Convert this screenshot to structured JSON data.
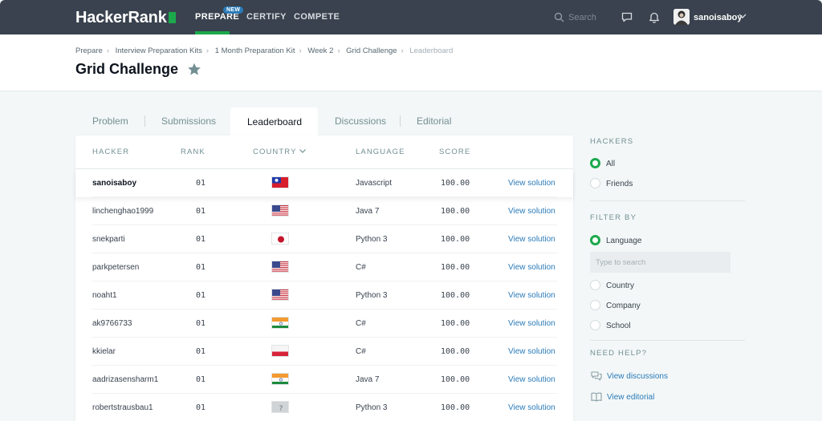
{
  "nav": {
    "logo": "HackerRank",
    "items": [
      {
        "label": "PREPARE",
        "active": true,
        "badge": "NEW"
      },
      {
        "label": "CERTIFY",
        "active": false
      },
      {
        "label": "COMPETE",
        "active": false
      }
    ],
    "search_placeholder": "Search",
    "username": "sanoisaboy",
    "icons": [
      "search-icon",
      "chat-icon",
      "bell-icon",
      "chevron-down-icon"
    ]
  },
  "breadcrumb": [
    "Prepare",
    "Interview Preparation Kits",
    "1 Month Preparation Kit",
    "Week 2",
    "Grid Challenge",
    "Leaderboard"
  ],
  "page_title": "Grid Challenge",
  "tabs": [
    "Problem",
    "Submissions",
    "Leaderboard",
    "Discussions",
    "Editorial"
  ],
  "active_tab": "Leaderboard",
  "table": {
    "headers": [
      "HACKER",
      "RANK",
      "COUNTRY",
      "LANGUAGE",
      "SCORE"
    ],
    "rows": [
      {
        "hacker": "sanoisaboy",
        "rank": "01",
        "country": "taiwan",
        "language": "Javascript",
        "score": "100.00",
        "action": "View solution"
      },
      {
        "hacker": "linchenghao1999",
        "rank": "01",
        "country": "usa",
        "language": "Java 7",
        "score": "100.00",
        "action": "View solution"
      },
      {
        "hacker": "snekparti",
        "rank": "01",
        "country": "japan",
        "language": "Python 3",
        "score": "100.00",
        "action": "View solution"
      },
      {
        "hacker": "parkpetersen",
        "rank": "01",
        "country": "usa",
        "language": "C#",
        "score": "100.00",
        "action": "View solution"
      },
      {
        "hacker": "noaht1",
        "rank": "01",
        "country": "usa",
        "language": "Python 3",
        "score": "100.00",
        "action": "View solution"
      },
      {
        "hacker": "ak9766733",
        "rank": "01",
        "country": "india",
        "language": "C#",
        "score": "100.00",
        "action": "View solution"
      },
      {
        "hacker": "kkielar",
        "rank": "01",
        "country": "poland",
        "language": "C#",
        "score": "100.00",
        "action": "View solution"
      },
      {
        "hacker": "aadrizasensharm1",
        "rank": "01",
        "country": "india",
        "language": "Java 7",
        "score": "100.00",
        "action": "View solution"
      },
      {
        "hacker": "robertstrausbau1",
        "rank": "01",
        "country": "unknown",
        "language": "Python 3",
        "score": "100.00",
        "action": "View solution"
      }
    ]
  },
  "sidebar": {
    "hackers_heading": "HACKERS",
    "hackers_options": [
      {
        "label": "All",
        "checked": true
      },
      {
        "label": "Friends",
        "checked": false
      }
    ],
    "filter_heading": "FILTER BY",
    "filter_options": [
      {
        "label": "Language",
        "checked": true
      },
      {
        "label": "Country",
        "checked": false
      },
      {
        "label": "Company",
        "checked": false
      },
      {
        "label": "School",
        "checked": false
      }
    ],
    "filter_placeholder": "Type to search",
    "help_heading": "NEED HELP?",
    "help_links": [
      "View discussions",
      "View editorial"
    ]
  },
  "colors": {
    "nav_bg": "#39424e",
    "accent_green": "#1ba94c",
    "link_blue": "#2b7bb9",
    "page_bg": "#f3f7f7"
  }
}
